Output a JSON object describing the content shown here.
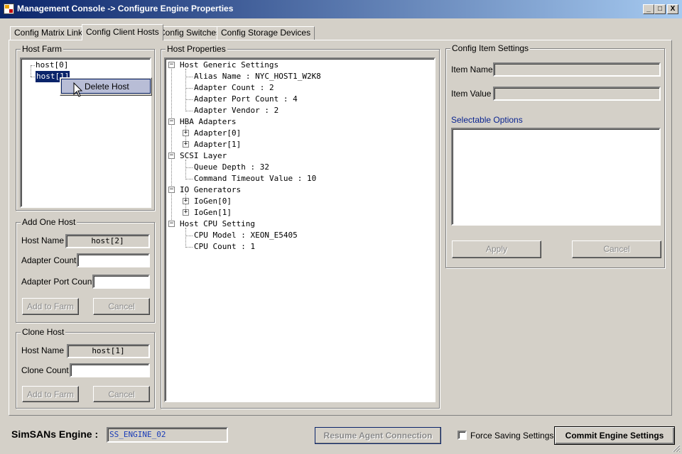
{
  "window": {
    "title": "Management Console -> Configure Engine Properties",
    "min_glyph": "_",
    "max_glyph": "□",
    "close_glyph": "X"
  },
  "tabs": [
    {
      "label": "Config Matrix Links",
      "active": false
    },
    {
      "label": "Config Client Hosts",
      "active": true
    },
    {
      "label": "Config Switches",
      "active": false
    },
    {
      "label": "Config Storage Devices",
      "active": false
    }
  ],
  "host_farm": {
    "title": "Host Farm",
    "items": [
      "host[0]",
      "host[1]"
    ],
    "selected_index": 1,
    "context_menu": {
      "item": "Delete Host"
    }
  },
  "add_one_host": {
    "title": "Add One Host",
    "host_name_label": "Host Name",
    "host_name_value": "host[2]",
    "adapter_count_label": "Adapter Count",
    "adapter_count_value": "",
    "adapter_port_count_label": "Adapter Port Count",
    "adapter_port_count_value": "",
    "add_button": "Add to Farm",
    "cancel_button": "Cancel"
  },
  "clone_host": {
    "title": "Clone Host",
    "host_name_label": "Host Name",
    "host_name_value": "host[1]",
    "clone_count_label": "Clone Count",
    "clone_count_value": "",
    "add_button": "Add to Farm",
    "cancel_button": "Cancel"
  },
  "host_properties": {
    "title": "Host Properties",
    "tree": {
      "generic": "Host Generic Settings",
      "alias": "Alias Name : NYC_HOST1_W2K8",
      "adapter_count": "Adapter Count : 2",
      "adapter_port_count": "Adapter Port Count : 4",
      "adapter_vendor": "Adapter Vendor : 2",
      "hba": "HBA Adapters",
      "adapter0": "Adapter[0]",
      "adapter1": "Adapter[1]",
      "scsi": "SCSI Layer",
      "queue_depth": "Queue Depth : 32",
      "cmd_timeout": "Command Timeout Value : 10",
      "io": "IO Generators",
      "iogen0": "IoGen[0]",
      "iogen1": "IoGen[1]",
      "cpu": "Host CPU Setting",
      "cpu_model": "CPU Model : XEON_E5405",
      "cpu_count": "CPU Count : 1"
    }
  },
  "config_item": {
    "title": "Config Item Settings",
    "item_name_label": "Item Name",
    "item_name_value": "",
    "item_value_label": "Item Value",
    "item_value_value": "",
    "selectable_options_label": "Selectable Options",
    "apply_button": "Apply",
    "cancel_button": "Cancel"
  },
  "footer": {
    "engine_label": "SimSANs Engine :",
    "engine_value": "SS_ENGINE_02",
    "resume_button": "Resume Agent Connection",
    "force_saving_label": "Force Saving Settings",
    "force_saving_checked": false,
    "commit_button": "Commit Engine Settings"
  },
  "colors": {
    "titlebar_start": "#0a246a",
    "titlebar_end": "#a6caf0",
    "face": "#d4d0c8",
    "selection": "#0a246a",
    "link_blue": "#0a2490",
    "engine_text": "#1a3cb8"
  }
}
